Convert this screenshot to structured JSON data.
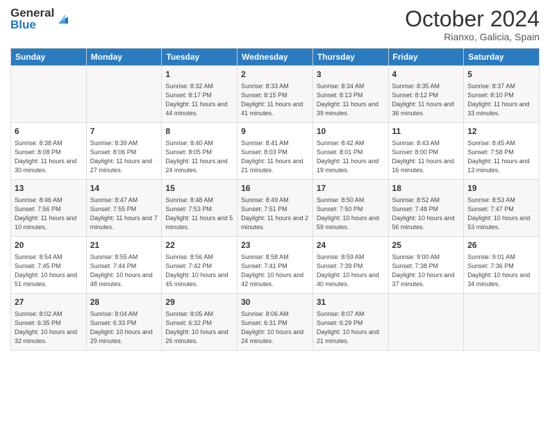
{
  "header": {
    "logo_general": "General",
    "logo_blue": "Blue",
    "month_title": "October 2024",
    "location": "Rianxo, Galicia, Spain"
  },
  "weekdays": [
    "Sunday",
    "Monday",
    "Tuesday",
    "Wednesday",
    "Thursday",
    "Friday",
    "Saturday"
  ],
  "weeks": [
    [
      {
        "day": "",
        "content": ""
      },
      {
        "day": "",
        "content": ""
      },
      {
        "day": "1",
        "content": "Sunrise: 8:32 AM\nSunset: 8:17 PM\nDaylight: 11 hours and 44 minutes."
      },
      {
        "day": "2",
        "content": "Sunrise: 8:33 AM\nSunset: 8:15 PM\nDaylight: 11 hours and 41 minutes."
      },
      {
        "day": "3",
        "content": "Sunrise: 8:34 AM\nSunset: 8:13 PM\nDaylight: 11 hours and 39 minutes."
      },
      {
        "day": "4",
        "content": "Sunrise: 8:35 AM\nSunset: 8:12 PM\nDaylight: 11 hours and 36 minutes."
      },
      {
        "day": "5",
        "content": "Sunrise: 8:37 AM\nSunset: 8:10 PM\nDaylight: 11 hours and 33 minutes."
      }
    ],
    [
      {
        "day": "6",
        "content": "Sunrise: 8:38 AM\nSunset: 8:08 PM\nDaylight: 11 hours and 30 minutes."
      },
      {
        "day": "7",
        "content": "Sunrise: 8:39 AM\nSunset: 8:06 PM\nDaylight: 11 hours and 27 minutes."
      },
      {
        "day": "8",
        "content": "Sunrise: 8:40 AM\nSunset: 8:05 PM\nDaylight: 11 hours and 24 minutes."
      },
      {
        "day": "9",
        "content": "Sunrise: 8:41 AM\nSunset: 8:03 PM\nDaylight: 11 hours and 21 minutes."
      },
      {
        "day": "10",
        "content": "Sunrise: 8:42 AM\nSunset: 8:01 PM\nDaylight: 11 hours and 19 minutes."
      },
      {
        "day": "11",
        "content": "Sunrise: 8:43 AM\nSunset: 8:00 PM\nDaylight: 11 hours and 16 minutes."
      },
      {
        "day": "12",
        "content": "Sunrise: 8:45 AM\nSunset: 7:58 PM\nDaylight: 11 hours and 13 minutes."
      }
    ],
    [
      {
        "day": "13",
        "content": "Sunrise: 8:46 AM\nSunset: 7:56 PM\nDaylight: 11 hours and 10 minutes."
      },
      {
        "day": "14",
        "content": "Sunrise: 8:47 AM\nSunset: 7:55 PM\nDaylight: 11 hours and 7 minutes."
      },
      {
        "day": "15",
        "content": "Sunrise: 8:48 AM\nSunset: 7:53 PM\nDaylight: 11 hours and 5 minutes."
      },
      {
        "day": "16",
        "content": "Sunrise: 8:49 AM\nSunset: 7:51 PM\nDaylight: 11 hours and 2 minutes."
      },
      {
        "day": "17",
        "content": "Sunrise: 8:50 AM\nSunset: 7:50 PM\nDaylight: 10 hours and 59 minutes."
      },
      {
        "day": "18",
        "content": "Sunrise: 8:52 AM\nSunset: 7:48 PM\nDaylight: 10 hours and 56 minutes."
      },
      {
        "day": "19",
        "content": "Sunrise: 8:53 AM\nSunset: 7:47 PM\nDaylight: 10 hours and 53 minutes."
      }
    ],
    [
      {
        "day": "20",
        "content": "Sunrise: 8:54 AM\nSunset: 7:45 PM\nDaylight: 10 hours and 51 minutes."
      },
      {
        "day": "21",
        "content": "Sunrise: 8:55 AM\nSunset: 7:44 PM\nDaylight: 10 hours and 48 minutes."
      },
      {
        "day": "22",
        "content": "Sunrise: 8:56 AM\nSunset: 7:42 PM\nDaylight: 10 hours and 45 minutes."
      },
      {
        "day": "23",
        "content": "Sunrise: 8:58 AM\nSunset: 7:41 PM\nDaylight: 10 hours and 42 minutes."
      },
      {
        "day": "24",
        "content": "Sunrise: 8:59 AM\nSunset: 7:39 PM\nDaylight: 10 hours and 40 minutes."
      },
      {
        "day": "25",
        "content": "Sunrise: 9:00 AM\nSunset: 7:38 PM\nDaylight: 10 hours and 37 minutes."
      },
      {
        "day": "26",
        "content": "Sunrise: 9:01 AM\nSunset: 7:36 PM\nDaylight: 10 hours and 34 minutes."
      }
    ],
    [
      {
        "day": "27",
        "content": "Sunrise: 8:02 AM\nSunset: 6:35 PM\nDaylight: 10 hours and 32 minutes."
      },
      {
        "day": "28",
        "content": "Sunrise: 8:04 AM\nSunset: 6:33 PM\nDaylight: 10 hours and 29 minutes."
      },
      {
        "day": "29",
        "content": "Sunrise: 8:05 AM\nSunset: 6:32 PM\nDaylight: 10 hours and 26 minutes."
      },
      {
        "day": "30",
        "content": "Sunrise: 8:06 AM\nSunset: 6:31 PM\nDaylight: 10 hours and 24 minutes."
      },
      {
        "day": "31",
        "content": "Sunrise: 8:07 AM\nSunset: 6:29 PM\nDaylight: 10 hours and 21 minutes."
      },
      {
        "day": "",
        "content": ""
      },
      {
        "day": "",
        "content": ""
      }
    ]
  ]
}
